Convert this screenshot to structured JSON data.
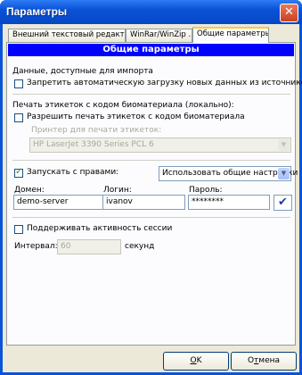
{
  "window": {
    "title": "Параметры",
    "close_glyph": "✕"
  },
  "tabs": [
    {
      "label": "Внешний текстовый редактор"
    },
    {
      "label": "WinRar/WinZip ..."
    },
    {
      "label": "Общие параметры"
    }
  ],
  "panel": {
    "header": "Общие параметры",
    "import_group": {
      "title": "Данные, доступные для импорта",
      "block_auto_load": {
        "label": "Запретить автоматическую загрузку новых данных из источников",
        "checked": false
      }
    },
    "labels_group": {
      "title": "Печать этикеток с кодом биоматериала (локально):",
      "allow_print": {
        "label": "Разрешить печать этикеток с кодом биоматериала",
        "checked": false
      },
      "printer_label": "Принтер для печати этикеток:",
      "printer_value": "HP LaserJet 3390 Series PCL 6"
    },
    "run_as": {
      "label": "Запускать с правами:",
      "checked": true,
      "mode_value": "Использовать общие настройки",
      "domain_label": "Домен:",
      "domain_value": "demo-server",
      "login_label": "Логин:",
      "login_value": "ivanov",
      "password_label": "Пароль:",
      "password_value": "********"
    },
    "session": {
      "keep_alive": {
        "label": "Поддерживать активность сессии",
        "checked": false
      },
      "interval_label": "Интервал:",
      "interval_value": "60",
      "interval_unit": "секунд"
    }
  },
  "buttons": {
    "ok_underlined": "O",
    "ok_rest": "K",
    "cancel_first": "О",
    "cancel_underlined": "т",
    "cancel_rest": "мена"
  },
  "icons": {
    "check": "✔",
    "dropdown": "▼"
  },
  "colors": {
    "header_bg": "#0000ff",
    "title_bar": "#0a54d8",
    "panel_bg": "#fcfcfe"
  }
}
